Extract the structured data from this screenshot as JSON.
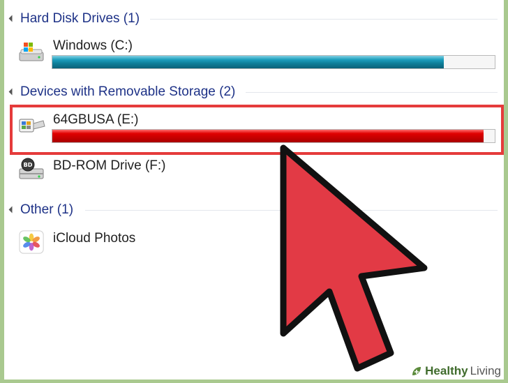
{
  "groups": [
    {
      "title": "Hard Disk Drives (1)"
    },
    {
      "title": "Devices with Removable Storage (2)"
    },
    {
      "title": "Other (1)"
    }
  ],
  "drives": {
    "windows": {
      "name": "Windows (C:)",
      "used_fraction": 0.885,
      "bar_color": "#1d9fbd"
    },
    "usb": {
      "name": "64GBUSA (E:)",
      "used_fraction": 0.975,
      "bar_color": "#d40000"
    },
    "bdrom": {
      "name": "BD-ROM Drive (F:)"
    },
    "icloud": {
      "name": "iCloud Photos"
    }
  },
  "highlight_color": "#e53b3b",
  "cursor_color": "#e23a45",
  "watermark": {
    "part1": "Healthy",
    "part2": "Living"
  }
}
